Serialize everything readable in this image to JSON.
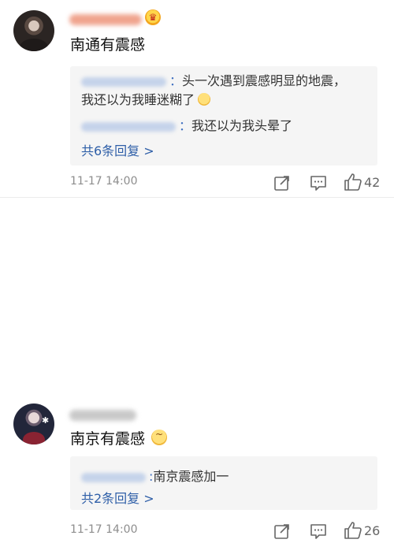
{
  "comments": [
    {
      "content": "南通有震感",
      "replies": [
        {
          "separator": "：",
          "text": "头一次遇到震感明显的地震，",
          "text_cont": "我还以为我睡迷糊了",
          "emoji": "laugh-cry-emoji"
        },
        {
          "separator": "：",
          "text": "我还以为我头晕了"
        }
      ],
      "more_replies": "共6条回复 >",
      "timestamp": "11-17 14:00",
      "likes": "42"
    },
    {
      "content": "南京有震感",
      "emoji": "sweat-smile-emoji",
      "replies": [
        {
          "separator": ":",
          "text": "南京震感加一"
        }
      ],
      "more_replies": "共2条回复 >",
      "timestamp": "11-17 14:00",
      "likes": "26"
    }
  ],
  "icons": {
    "share": "share-icon",
    "comment": "comment-icon",
    "like": "thumbs-up-icon",
    "badge": "crown-badge-icon"
  },
  "colors": {
    "link": "#2f5fa8",
    "reply_bg": "#f5f5f5",
    "meta": "#8d8d8d"
  }
}
